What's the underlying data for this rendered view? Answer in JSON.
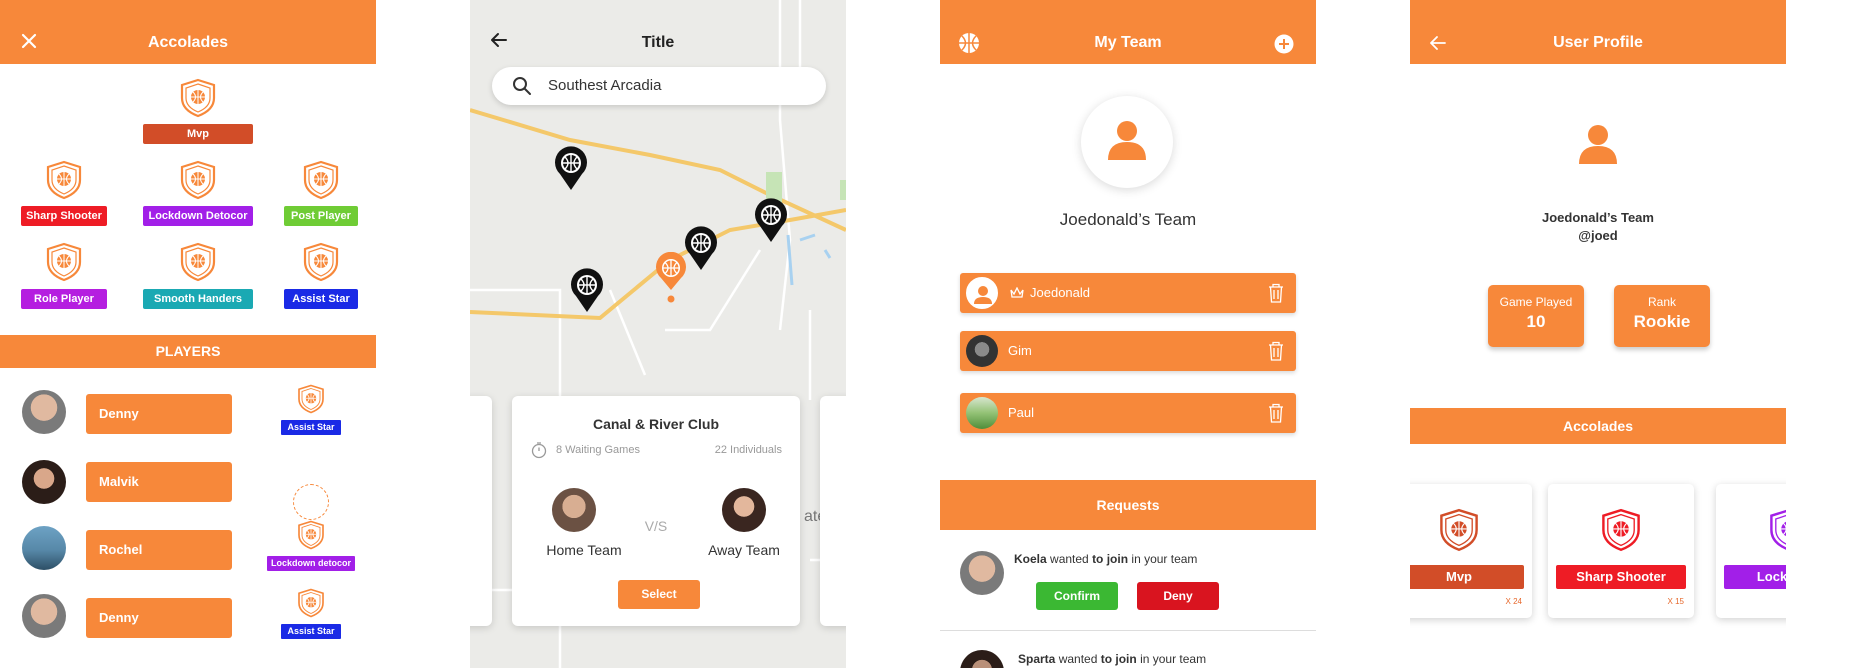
{
  "colors": {
    "primary": "#f7883a",
    "mvp": "#d24d28",
    "sharp_shooter": "#ee1c25",
    "lockdown": "#a21fe8",
    "post_player": "#6fcc35",
    "role_player": "#b51ee0",
    "smooth_handlers": "#1aa9b3",
    "assist_star": "#1a2ae6",
    "confirm": "#3bb833",
    "deny": "#d9141f"
  },
  "accolades_screen": {
    "title": "Accolades",
    "close_icon": "close-icon",
    "badges": [
      {
        "label": "Mvp",
        "color": "#d24d28"
      },
      {
        "label": "Sharp Shooter",
        "color": "#ee1c25"
      },
      {
        "label": "Lockdown Detocor",
        "color": "#a21fe8"
      },
      {
        "label": "Post Player",
        "color": "#6fcc35"
      },
      {
        "label": "Role Player",
        "color": "#b51ee0"
      },
      {
        "label": "Smooth Handers",
        "color": "#1aa9b3"
      },
      {
        "label": "Assist Star",
        "color": "#1a2ae6"
      }
    ],
    "players_header": "PLAYERS",
    "players": [
      {
        "name": "Denny",
        "badge": "Assist Star"
      },
      {
        "name": "Malvik",
        "badge": ""
      },
      {
        "name": "Rochel",
        "badge": "Lockdown detocor"
      },
      {
        "name": "Denny",
        "badge": "Assist Star"
      }
    ]
  },
  "map_screen": {
    "title": "Title",
    "search_value": "Southest Arcadia",
    "map_text": "ate",
    "card": {
      "club": "Canal & River Club",
      "waiting": "8 Waiting Games",
      "individuals": "22 Individuals",
      "home_team": "Home Team",
      "vs": "V/S",
      "away_team": "Away Team",
      "select_label": "Select"
    }
  },
  "team_screen": {
    "title": "My Team",
    "team_name": "Joedonald’s Team",
    "members": [
      {
        "name": "Joedonald",
        "captain": true
      },
      {
        "name": "Gim",
        "captain": false
      },
      {
        "name": "Paul",
        "captain": false
      }
    ],
    "requests_header": "Requests",
    "requests": [
      {
        "name": "Koela",
        "text_a": " wanted ",
        "text_b": "to join",
        "text_c": " in your team",
        "confirm": "Confirm",
        "deny": "Deny"
      },
      {
        "name": "Sparta",
        "text_a": " wanted ",
        "text_b": "to join",
        "text_c": " in your team"
      }
    ]
  },
  "profile_screen": {
    "title": "User Profile",
    "team_name": "Joedonald’s Team",
    "handle": "@joed",
    "stats": [
      {
        "label": "Game Played",
        "value": "10"
      },
      {
        "label": "Rank",
        "value": "Rookie"
      }
    ],
    "accolades_header": "Accolades",
    "accolades": [
      {
        "label": "Mvp",
        "count": "X 24",
        "color": "#d24d28"
      },
      {
        "label": "Sharp Shooter",
        "count": "X 15",
        "color": "#ee1c25"
      },
      {
        "label": "Lockdown",
        "count": "",
        "color": "#a21fe8"
      }
    ]
  }
}
